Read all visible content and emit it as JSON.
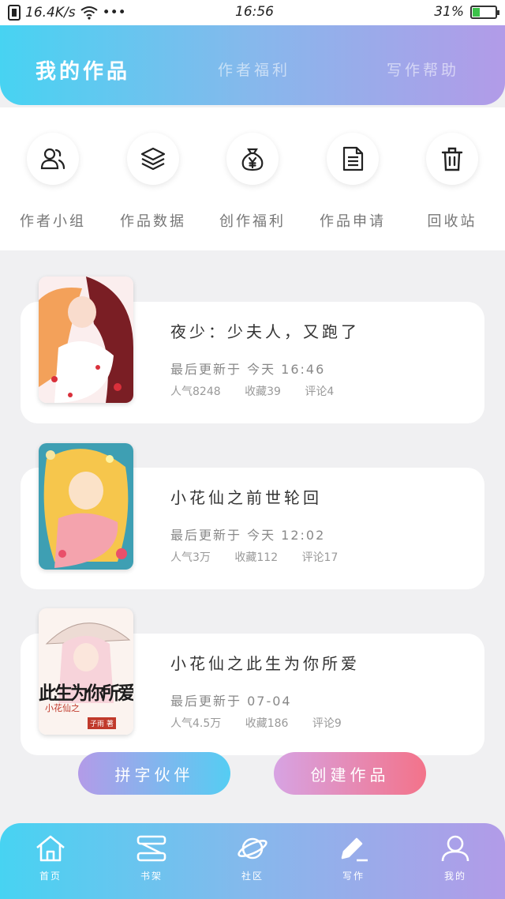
{
  "status_bar": {
    "network_speed": "16.4K/s",
    "more": "•••",
    "time": "16:56",
    "battery_percent": "31%",
    "battery_level": 0.31
  },
  "header": {
    "tabs": [
      {
        "label": "我的作品",
        "active": true
      },
      {
        "label": "作者福利",
        "active": false
      },
      {
        "label": "写作帮助",
        "active": false
      }
    ]
  },
  "quick_actions": [
    {
      "label": "作者小组",
      "icon": "author-group-icon"
    },
    {
      "label": "作品数据",
      "icon": "layers-icon"
    },
    {
      "label": "创作福利",
      "icon": "money-bag-icon"
    },
    {
      "label": "作品申请",
      "icon": "document-icon"
    },
    {
      "label": "回收站",
      "icon": "trash-icon"
    }
  ],
  "works": [
    {
      "title": "夜少：少夫人，又跑了",
      "updated": "最后更新于 今天 16:46",
      "popularity": "人气8248",
      "favorites": "收藏39",
      "comments": "评论4"
    },
    {
      "title": "小花仙之前世轮回",
      "updated": "最后更新于 今天 12:02",
      "popularity": "人气3万",
      "favorites": "收藏112",
      "comments": "评论17"
    },
    {
      "title": "小花仙之此生为你所爱",
      "updated": "最后更新于 07-04",
      "popularity": "人气4.5万",
      "favorites": "收藏186",
      "comments": "评论9",
      "cover_text": "此生为你所爱",
      "cover_subtitle": "小花仙之",
      "cover_author": "子雨 著"
    }
  ],
  "actions": {
    "partner": "拼字伙伴",
    "create": "创建作品"
  },
  "bottom_nav": [
    {
      "label": "首页",
      "icon": "home-icon"
    },
    {
      "label": "书架",
      "icon": "bookshelf-icon"
    },
    {
      "label": "社区",
      "icon": "planet-icon"
    },
    {
      "label": "写作",
      "icon": "pen-icon"
    },
    {
      "label": "我的",
      "icon": "profile-icon"
    }
  ],
  "colors": {
    "gradient_start": "#47d3f2",
    "gradient_end": "#b29be8",
    "create_button_end": "#f3738a",
    "battery_fill": "#3cc24a"
  }
}
